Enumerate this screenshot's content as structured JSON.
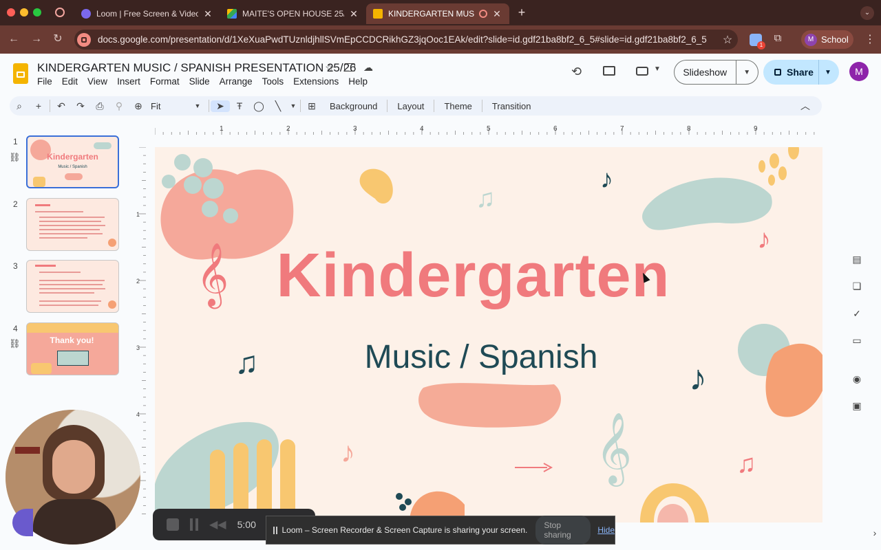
{
  "browser": {
    "tabs": [
      {
        "title": "Loom | Free Screen & Video R",
        "active": false
      },
      {
        "title": "MAITE'S OPEN HOUSE 25/26",
        "active": false
      },
      {
        "title": "KINDERGARTEN MUSIC /",
        "active": true
      }
    ],
    "new_tab": "+",
    "url": "docs.google.com/presentation/d/1XeXuaPwdTUznldjhllSVmEpCCDCRikhGZ3jqOoc1EAk/edit?slide=id.gdf21ba8bf2_6_5#slide=id.gdf21ba8bf2_6_5",
    "profile_initial": "M",
    "profile_name": "School",
    "extension_badge": "1"
  },
  "docs": {
    "title": "KINDERGARTEN MUSIC / SPANISH PRESENTATION 25/26",
    "menu": [
      "File",
      "Edit",
      "View",
      "Insert",
      "Format",
      "Slide",
      "Arrange",
      "Tools",
      "Extensions",
      "Help"
    ],
    "slideshow_label": "Slideshow",
    "share_label": "Share",
    "avatar_initial": "M",
    "zoom": "Fit",
    "toolbar_text": [
      "Background",
      "Layout",
      "Theme",
      "Transition"
    ]
  },
  "ruler": {
    "h_marks": [
      "1",
      "2",
      "3",
      "4",
      "5",
      "6",
      "7",
      "8",
      "9"
    ],
    "v_marks": [
      "1",
      "2",
      "3",
      "4"
    ]
  },
  "filmstrip": [
    {
      "num": "1",
      "title": "Kindergarten",
      "subtitle": "Music / Spanish",
      "selected": true
    },
    {
      "num": "2",
      "selected": false
    },
    {
      "num": "3",
      "selected": false
    },
    {
      "num": "4",
      "title": "Thank you!",
      "selected": false
    }
  ],
  "slide": {
    "title": "Kindergarten",
    "subtitle": "Music / Spanish",
    "title_color": "#f07a7d",
    "subtitle_color": "#1f4a55"
  },
  "loom": {
    "timer": "5:00",
    "share_message": "Loom – Screen Recorder & Screen Capture is sharing your screen.",
    "stop_label": "Stop sharing",
    "hide_label": "Hide"
  },
  "colors": {
    "accent": "#3a6fd8",
    "share_bg": "#c2e7ff",
    "tab_active": "#6a3b33"
  }
}
